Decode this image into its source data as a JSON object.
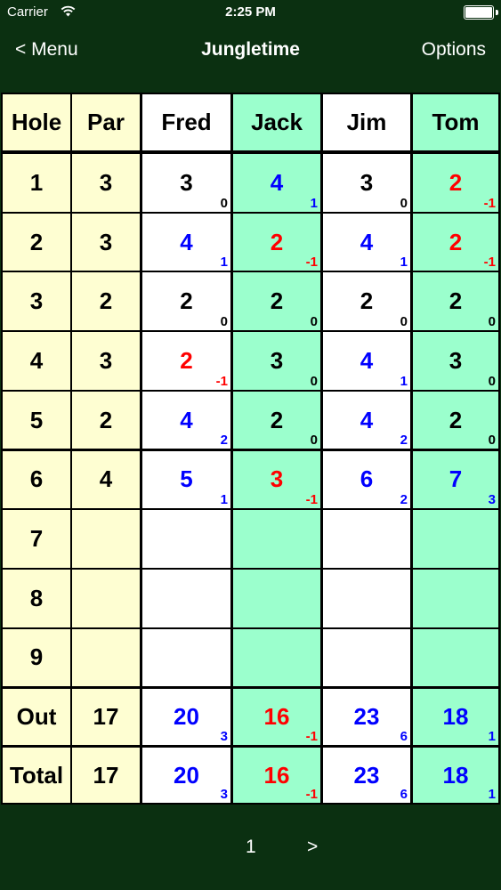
{
  "status": {
    "carrier": "Carrier",
    "time": "2:25 PM"
  },
  "nav": {
    "back": "< Menu",
    "title": "Jungletime",
    "options": "Options"
  },
  "colors": {
    "background": "#0b3011",
    "yellow": "#fefed2",
    "white": "#ffffff",
    "green": "#9bffcd",
    "under": "#0000ff",
    "over": "#ff0000",
    "even": "#000000"
  },
  "columns": [
    "Hole",
    "Par",
    "Fred",
    "Jack",
    "Jim",
    "Tom"
  ],
  "holes": [
    {
      "hole": "1",
      "par": "3",
      "scores": [
        {
          "s": "3",
          "d": "0"
        },
        {
          "s": "4",
          "d": "1"
        },
        {
          "s": "3",
          "d": "0"
        },
        {
          "s": "2",
          "d": "-1"
        }
      ]
    },
    {
      "hole": "2",
      "par": "3",
      "scores": [
        {
          "s": "4",
          "d": "1"
        },
        {
          "s": "2",
          "d": "-1"
        },
        {
          "s": "4",
          "d": "1"
        },
        {
          "s": "2",
          "d": "-1"
        }
      ]
    },
    {
      "hole": "3",
      "par": "2",
      "scores": [
        {
          "s": "2",
          "d": "0"
        },
        {
          "s": "2",
          "d": "0"
        },
        {
          "s": "2",
          "d": "0"
        },
        {
          "s": "2",
          "d": "0"
        }
      ]
    },
    {
      "hole": "4",
      "par": "3",
      "scores": [
        {
          "s": "2",
          "d": "-1"
        },
        {
          "s": "3",
          "d": "0"
        },
        {
          "s": "4",
          "d": "1"
        },
        {
          "s": "3",
          "d": "0"
        }
      ]
    },
    {
      "hole": "5",
      "par": "2",
      "scores": [
        {
          "s": "4",
          "d": "2"
        },
        {
          "s": "2",
          "d": "0"
        },
        {
          "s": "4",
          "d": "2"
        },
        {
          "s": "2",
          "d": "0"
        }
      ]
    },
    {
      "hole": "6",
      "par": "4",
      "scores": [
        {
          "s": "5",
          "d": "1"
        },
        {
          "s": "3",
          "d": "-1"
        },
        {
          "s": "6",
          "d": "2"
        },
        {
          "s": "7",
          "d": "3"
        }
      ]
    },
    {
      "hole": "7",
      "par": "",
      "scores": [
        {
          "s": "",
          "d": ""
        },
        {
          "s": "",
          "d": ""
        },
        {
          "s": "",
          "d": ""
        },
        {
          "s": "",
          "d": ""
        }
      ]
    },
    {
      "hole": "8",
      "par": "",
      "scores": [
        {
          "s": "",
          "d": ""
        },
        {
          "s": "",
          "d": ""
        },
        {
          "s": "",
          "d": ""
        },
        {
          "s": "",
          "d": ""
        }
      ]
    },
    {
      "hole": "9",
      "par": "",
      "scores": [
        {
          "s": "",
          "d": ""
        },
        {
          "s": "",
          "d": ""
        },
        {
          "s": "",
          "d": ""
        },
        {
          "s": "",
          "d": ""
        }
      ]
    }
  ],
  "totals": [
    {
      "label": "Out",
      "par": "17",
      "scores": [
        {
          "s": "20",
          "d": "3"
        },
        {
          "s": "16",
          "d": "-1"
        },
        {
          "s": "23",
          "d": "6"
        },
        {
          "s": "18",
          "d": "1"
        }
      ]
    },
    {
      "label": "Total",
      "par": "17",
      "scores": [
        {
          "s": "20",
          "d": "3"
        },
        {
          "s": "16",
          "d": "-1"
        },
        {
          "s": "23",
          "d": "6"
        },
        {
          "s": "18",
          "d": "1"
        }
      ]
    }
  ],
  "pager": {
    "page": "1",
    "next": ">"
  }
}
